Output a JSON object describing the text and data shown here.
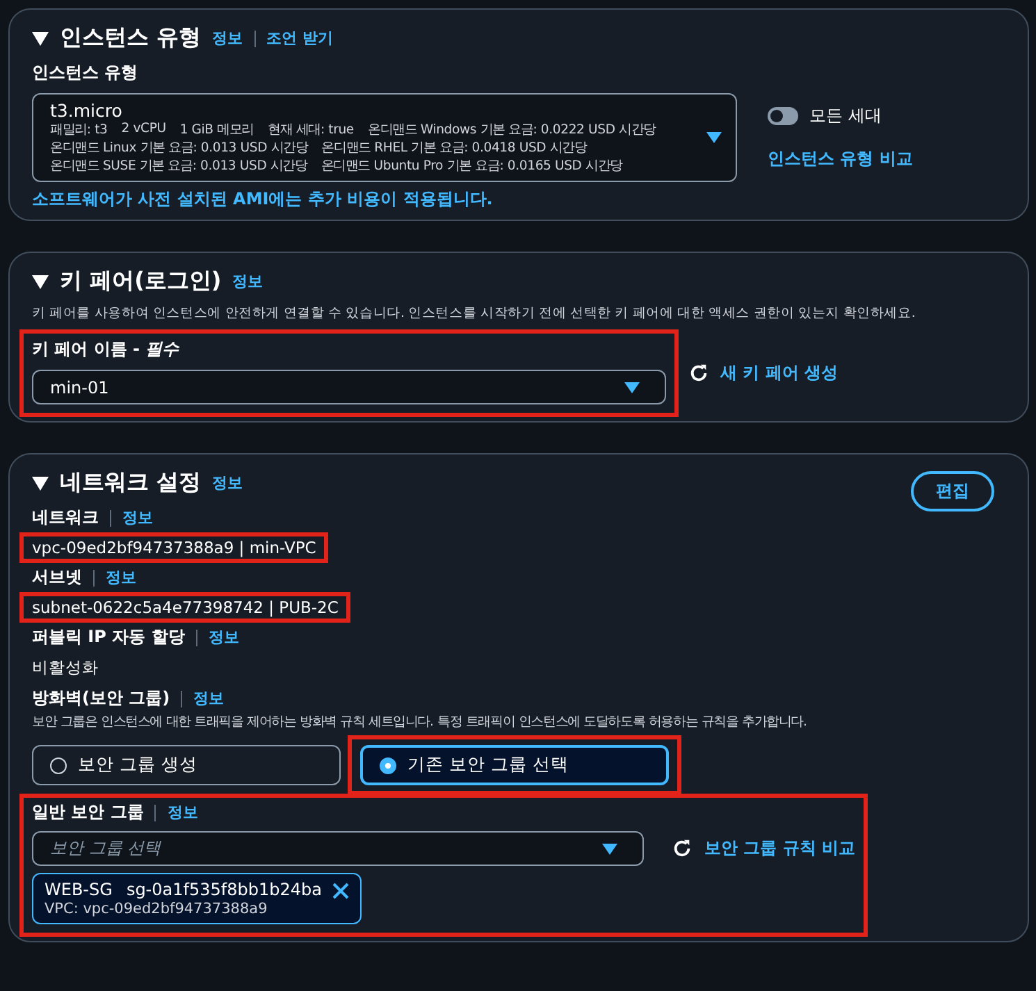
{
  "instance_type": {
    "title": "인스턴스 유형",
    "expanded": true,
    "links": [
      "정보",
      "조언 받기"
    ],
    "field_label": "인스턴스 유형",
    "selection": {
      "name": "t3.micro",
      "lines": [
        [
          "패밀리: t3",
          "2 vCPU",
          "1 GiB 메모리",
          "현재 세대: true",
          "온디맨드 Windows 기본 요금: 0.0222 USD 시간당"
        ],
        [
          "온디맨드 Linux 기본 요금: 0.013 USD 시간당",
          "온디맨드 RHEL 기본 요금: 0.0418 USD 시간당"
        ],
        [
          "온디맨드 SUSE 기본 요금: 0.013 USD 시간당",
          "온디맨드 Ubuntu Pro 기본 요금: 0.0165 USD 시간당"
        ]
      ]
    },
    "toggle": {
      "label": "모든 세대",
      "on": false
    },
    "compare_link": "인스턴스 유형 비교",
    "notice": "소프트웨어가 사전 설치된 AMI에는 추가 비용이 적용됩니다."
  },
  "key_pair": {
    "title": "키 페어(로그인)",
    "expanded": true,
    "links": [
      "정보"
    ],
    "description": "키 페어를 사용하여 인스턴스에 안전하게 연결할 수 있습니다. 인스턴스를 시작하기 전에 선택한 키 페어에 대한 액세스 권한이 있는지 확인하세요.",
    "field_label": "키 페어 이름 - *필수*",
    "value": "min-01",
    "highlighted": true,
    "create_link": "새 키 페어 생성"
  },
  "network": {
    "title": "네트워크 설정",
    "expanded": true,
    "links": [
      "정보"
    ],
    "edit_button": "편집",
    "fields": [
      {
        "label": "네트워크",
        "info": "정보",
        "value": "vpc-09ed2bf94737388a9 | min-VPC",
        "highlighted": true
      },
      {
        "label": "서브넷",
        "info": "정보",
        "value": "subnet-0622c5a4e77398742 | PUB-2C",
        "highlighted": true
      },
      {
        "label": "퍼블릭 IP 자동 할당",
        "info": "정보",
        "value": "비활성화",
        "highlighted": false
      }
    ],
    "firewall": {
      "label": "방화벽(보안 그룹)",
      "info": "정보",
      "description": "보안 그룹은 인스턴스에 대한 트래픽을 제어하는 방화벽 규칙 세트입니다. 특정 트래픽이 인스턴스에 도달하도록 허용하는 규칙을 추가합니다.",
      "options": [
        {
          "label": "보안 그룹 생성",
          "selected": false,
          "highlighted": false
        },
        {
          "label": "기존 보안 그룹 선택",
          "selected": true,
          "highlighted": true
        }
      ]
    },
    "security_groups": {
      "label": "일반 보안 그룹",
      "info": "정보",
      "placeholder": "보안 그룹 선택",
      "highlighted": true,
      "compare_link": "보안 그룹 규칙 비교",
      "chips": [
        {
          "name": "WEB-SG",
          "id": "sg-0a1f535f8bb1b24ba",
          "vpc": "VPC: vpc-09ed2bf94737388a9"
        }
      ]
    }
  }
}
